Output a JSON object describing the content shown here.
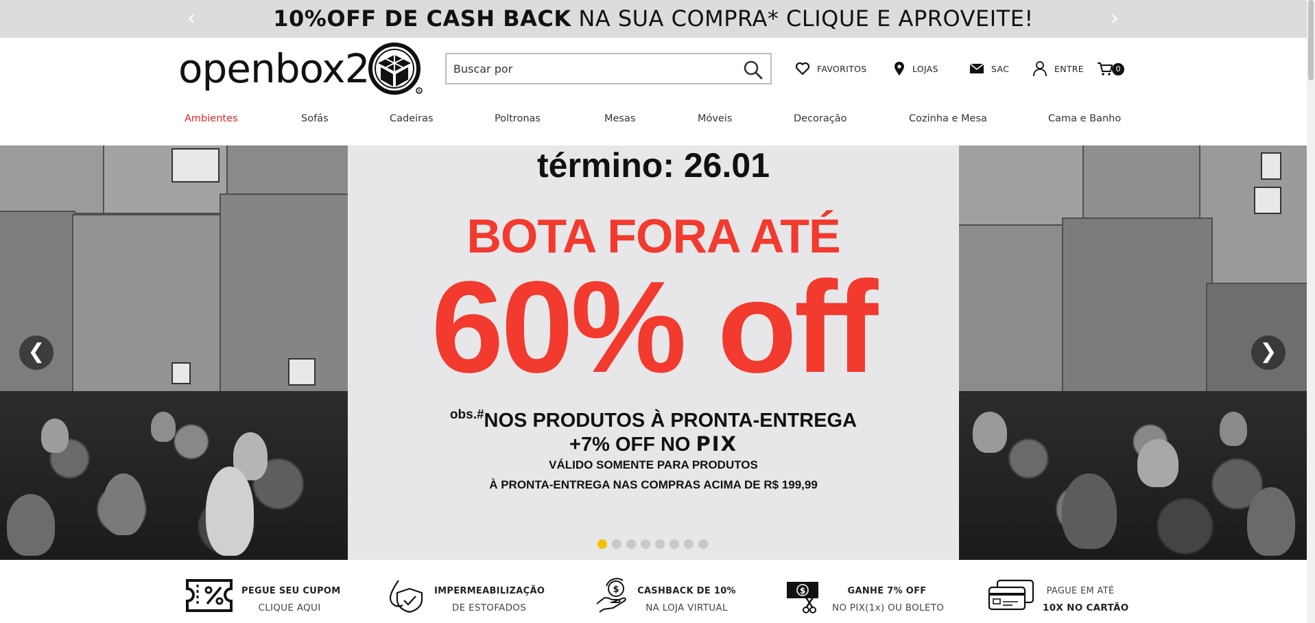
{
  "promo": {
    "bold_text": "10%OFF DE CASH BACK",
    "regular_text": " NA SUA COMPRA* CLIQUE E APROVEITE!",
    "prev_arrow": "‹",
    "next_arrow": "›"
  },
  "header": {
    "logo_text": "openbox2",
    "search_placeholder": "Buscar por",
    "links": {
      "favoritos": "FAVORITOS",
      "lojas": "LOJAS",
      "sac": "SAC",
      "entre": "ENTRE"
    },
    "cart_count": "0"
  },
  "nav": {
    "items": [
      "Ambientes",
      "Sofás",
      "Cadeiras",
      "Poltronas",
      "Mesas",
      "Móveis",
      "Decoração",
      "Cozinha e Mesa",
      "Cama e Banho"
    ],
    "active": "Ambientes"
  },
  "hero": {
    "termino": "término: 26.01",
    "bota_fora": "BOTA FORA ATÉ",
    "discount": "60% off",
    "obs": "obs.#",
    "line1": "NOS PRODUTOS À PRONTA-ENTREGA",
    "line2_prefix": "+7% OFF NO ",
    "line2_pix": "PIX",
    "line3": "VÁLIDO SOMENTE PARA PRODUTOS",
    "line4": "À PRONTA-ENTREGA NAS COMPRAS ACIMA DE R$ 199,99",
    "prev_arrow": "❮",
    "next_arrow": "❯",
    "slide_count": 8,
    "active_slide": 1
  },
  "benefits": [
    {
      "icon": "coupon-icon",
      "line1": "PEGUE SEU CUPOM",
      "line2": "CLIQUE AQUI"
    },
    {
      "icon": "waterproof-shield-icon",
      "line1": "IMPERMEABILIZAÇÃO",
      "line2": "DE ESTOFADOS"
    },
    {
      "icon": "cashback-hand-icon",
      "line1": "CASHBACK DE 10%",
      "line2": "NA LOJA VIRTUAL"
    },
    {
      "icon": "money-scissors-icon",
      "line1": "GANHE 7% OFF",
      "line2": "NO PIX(1x) OU BOLETO"
    },
    {
      "icon": "credit-cards-icon",
      "line1": "PAGUE EM ATÉ",
      "line2": "10X NO CARTÃO"
    }
  ],
  "colors": {
    "promo_bg": "#dcdcdc",
    "nav_active": "#e02323",
    "hero_red": "#f23a2e",
    "dot_active": "#f2c200"
  }
}
